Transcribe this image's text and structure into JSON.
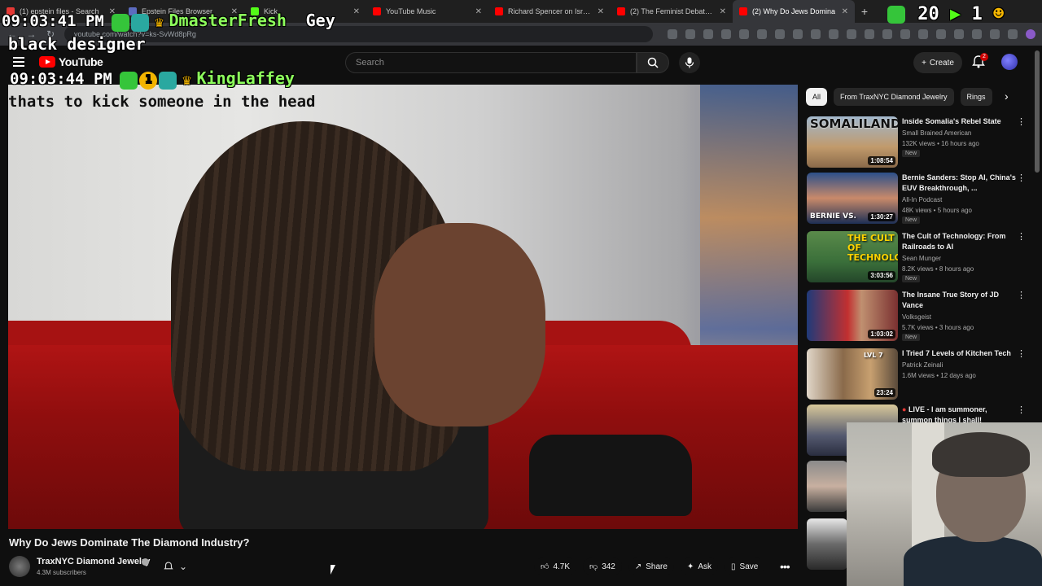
{
  "browser": {
    "tabs": [
      {
        "label": "(1) epstein files - Search",
        "color": "#e53935"
      },
      {
        "label": "Epstein Files Browser",
        "color": "#5c6bc0"
      },
      {
        "label": "Kick",
        "color": "#53fc18"
      },
      {
        "label": "YouTube Music",
        "color": "#ff0000"
      },
      {
        "label": "Richard Spencer on Israel, Ch",
        "color": "#ff0000"
      },
      {
        "label": "(2) The Feminist Debate - You",
        "color": "#ff0000"
      },
      {
        "label": "(2) Why Do Jews Domina",
        "color": "#ff0000"
      }
    ],
    "url": "youtube.com/watch?v=ks-SvWd8pRg"
  },
  "youtube": {
    "logo_text": "YouTube",
    "search_placeholder": "Search",
    "create_label": "Create",
    "notif_count": "2"
  },
  "stream_overlay": {
    "chat": [
      {
        "time": "09:03:41 PM",
        "user": "DmasterFresh",
        "text": "Gey"
      },
      {
        "text": "black designer"
      },
      {
        "time": "09:03:44 PM",
        "user": "KingLaffey"
      },
      {
        "text": "thats to kick someone in the head"
      }
    ],
    "top_right_text": "20",
    "top_right_count": "1"
  },
  "video": {
    "title": "Why Do Jews Dominate The Diamond Industry?",
    "channel": "TraxNYC Diamond Jewelry",
    "subscribers": "4.3M subscribers",
    "likes": "4.7K",
    "dislikes": "342",
    "share_label": "Share",
    "ask_label": "Ask",
    "save_label": "Save"
  },
  "sidebar": {
    "chips": [
      "All",
      "From TraxNYC Diamond Jewelry",
      "Rings"
    ],
    "recommendations": [
      {
        "title": "Inside Somalia's Rebel State",
        "channel": "Small Brained American",
        "meta": "132K views • 16 hours ago",
        "badge": "New",
        "duration": "1:08:54",
        "thumb_text": "SOMALILAND",
        "thumb_color": "#c19a6b"
      },
      {
        "title": "Bernie Sanders: Stop AI, China's EUV Breakthrough, ...",
        "channel": "All-In Podcast",
        "meta": "48K views • 5 hours ago",
        "badge": "New",
        "duration": "1:30:27",
        "thumb_text": "BERNIE VS.",
        "thumb_color": "#2b4f8a"
      },
      {
        "title": "The Cult of Technology: From Railroads to AI",
        "channel": "Sean Munger",
        "meta": "8.2K views • 8 hours ago",
        "badge": "New",
        "duration": "3:03:56",
        "thumb_text": "THE CULT OF TECHNOLOGY",
        "thumb_color": "#3a6f3a"
      },
      {
        "title": "The Insane True Story of JD Vance",
        "channel": "Volksgeist",
        "meta": "5.7K views • 3 hours ago",
        "badge": "New",
        "duration": "1:03:02",
        "thumb_text": "",
        "thumb_color": "#7a3030"
      },
      {
        "title": "I Tried 7 Levels of Kitchen Tech",
        "channel": "Patrick Zeinali",
        "meta": "1.6M views • 12 days ago",
        "badge": "",
        "duration": "23:24",
        "thumb_text": "LVL 7",
        "thumb_color": "#8a6a4a"
      },
      {
        "title": "LIVE - I am summoner, summon things I shall!",
        "channel": "",
        "meta": "",
        "badge": "",
        "duration": "",
        "thumb_text": "",
        "thumb_color": "#555a70"
      }
    ]
  }
}
